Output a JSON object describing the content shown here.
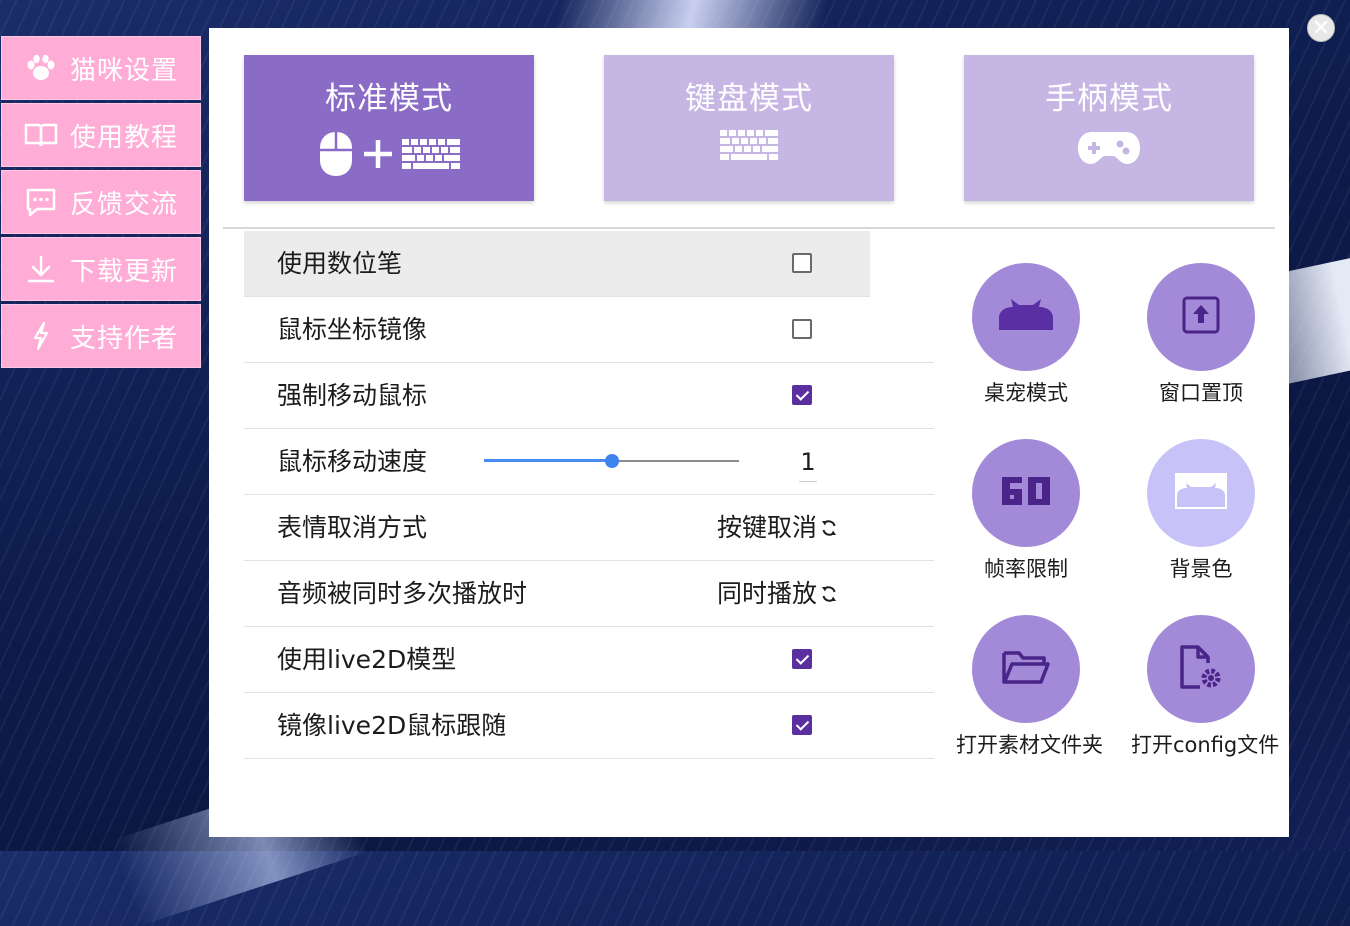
{
  "sidebar": {
    "items": [
      {
        "label": "猫咪设置",
        "icon": "paw-icon"
      },
      {
        "label": "使用教程",
        "icon": "book-icon"
      },
      {
        "label": "反馈交流",
        "icon": "chat-icon"
      },
      {
        "label": "下载更新",
        "icon": "download-icon"
      },
      {
        "label": "支持作者",
        "icon": "bolt-icon"
      }
    ]
  },
  "modes": [
    {
      "label": "标准模式",
      "active": true,
      "icons": [
        "mouse-icon",
        "plus-icon",
        "keyboard-icon"
      ]
    },
    {
      "label": "键盘模式",
      "active": false,
      "icons": [
        "keyboard-icon"
      ]
    },
    {
      "label": "手柄模式",
      "active": false,
      "icons": [
        "gamepad-icon"
      ]
    }
  ],
  "settings": {
    "digital_pen": {
      "label": "使用数位笔",
      "checked": false
    },
    "mouse_mirror": {
      "label": "鼠标坐标镜像",
      "checked": false
    },
    "force_move": {
      "label": "强制移动鼠标",
      "checked": true
    },
    "mouse_speed": {
      "label": "鼠标移动速度",
      "value": "1",
      "fraction": 0.5
    },
    "emote_cancel": {
      "label": "表情取消方式",
      "value": "按键取消"
    },
    "audio_multi": {
      "label": "音频被同时多次播放时",
      "value": "同时播放"
    },
    "use_live2d": {
      "label": "使用live2D模型",
      "checked": true
    },
    "mirror_live2d": {
      "label": "镜像live2D鼠标跟随",
      "checked": true
    }
  },
  "quick_actions": {
    "desktop_pet": {
      "label": "桌宠模式",
      "icon": "cat-silhouette-icon"
    },
    "always_on_top": {
      "label": "窗口置顶",
      "icon": "pin-top-icon"
    },
    "frame_limit": {
      "label": "帧率限制",
      "icon": "fps-60-icon"
    },
    "background_color": {
      "label": "背景色",
      "icon": "background-image-icon"
    },
    "open_assets": {
      "label": "打开素材文件夹",
      "icon": "folder-icon"
    },
    "open_config": {
      "label": "打开config文件",
      "icon": "file-settings-icon"
    }
  },
  "colors": {
    "sidebar": "#ffadd7",
    "mode_active": "#8a6cc7",
    "mode_inactive": "#c6b6e4",
    "accent_checkbox": "#5b2fa0",
    "slider": "#3f83ee",
    "quick_circle": "#a38ad8"
  }
}
